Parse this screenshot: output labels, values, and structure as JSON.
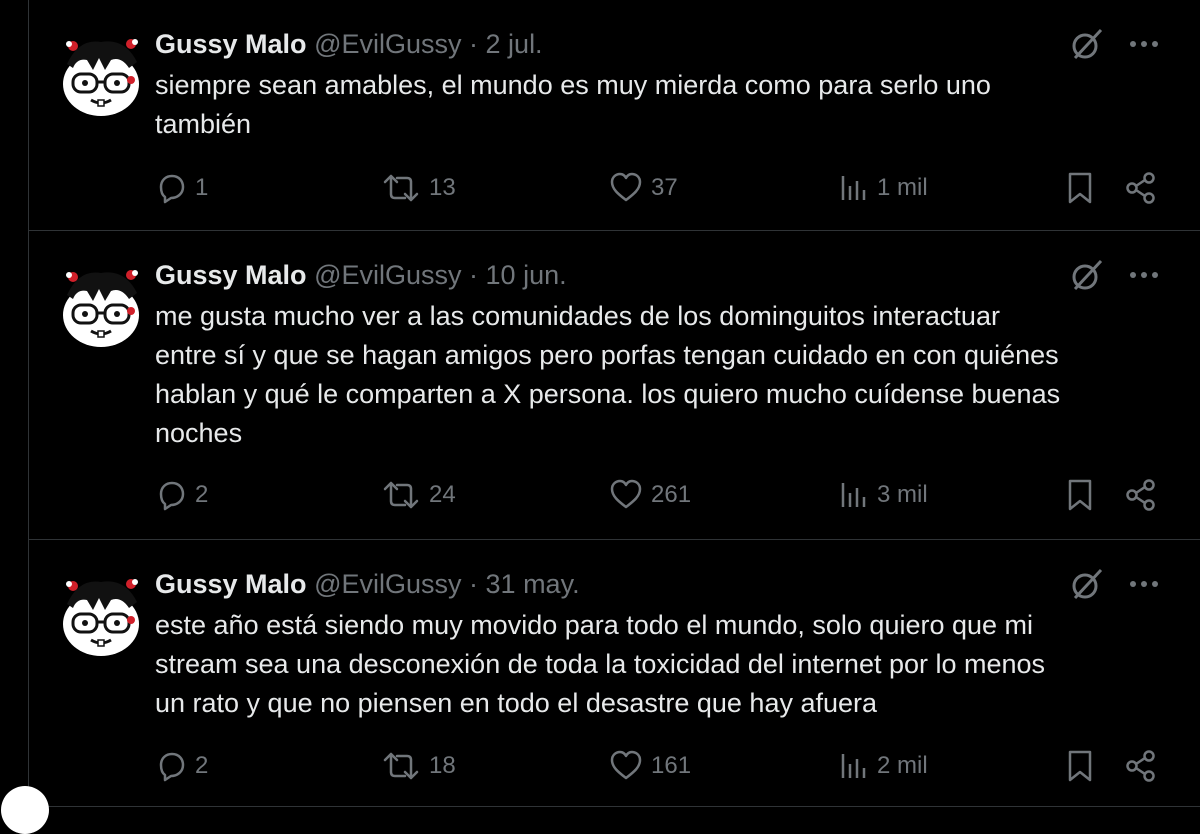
{
  "colors": {
    "background": "#000000",
    "text": "#e7e9ea",
    "muted": "#71767b",
    "border": "#2f3336"
  },
  "tweets": [
    {
      "name": "Gussy Malo",
      "handle": "@EvilGussy",
      "separator": "·",
      "date": "2 jul.",
      "lines": [
        "siempre sean amables, el mundo es muy mierda como para serlo uno",
        "también"
      ],
      "replies": "1",
      "retweets": "13",
      "likes": "37",
      "views": "1 mil"
    },
    {
      "name": "Gussy Malo",
      "handle": "@EvilGussy",
      "separator": "·",
      "date": "10 jun.",
      "lines": [
        "me gusta mucho ver a las comunidades de los dominguitos interactuar",
        "entre sí y que se hagan amigos pero porfas tengan cuidado en con quiénes",
        "hablan y qué le comparten a X persona. los quiero mucho cuídense buenas",
        "noches"
      ],
      "replies": "2",
      "retweets": "24",
      "likes": "261",
      "views": "3 mil"
    },
    {
      "name": "Gussy Malo",
      "handle": "@EvilGussy",
      "separator": "·",
      "date": "31 may.",
      "lines": [
        "este año está siendo muy movido para todo el mundo, solo quiero que mi",
        "stream sea una desconexión de toda la toxicidad del internet por lo menos",
        "un rato y que no piensen en todo el desastre que hay afuera"
      ],
      "replies": "2",
      "retweets": "18",
      "likes": "161",
      "views": "2 mil"
    }
  ],
  "icons": {
    "reply": "reply-icon",
    "retweet": "retweet-icon",
    "like": "like-icon",
    "views": "views-icon",
    "bookmark": "bookmark-icon",
    "share": "share-icon",
    "grok": "grok-icon",
    "more": "more-icon"
  }
}
